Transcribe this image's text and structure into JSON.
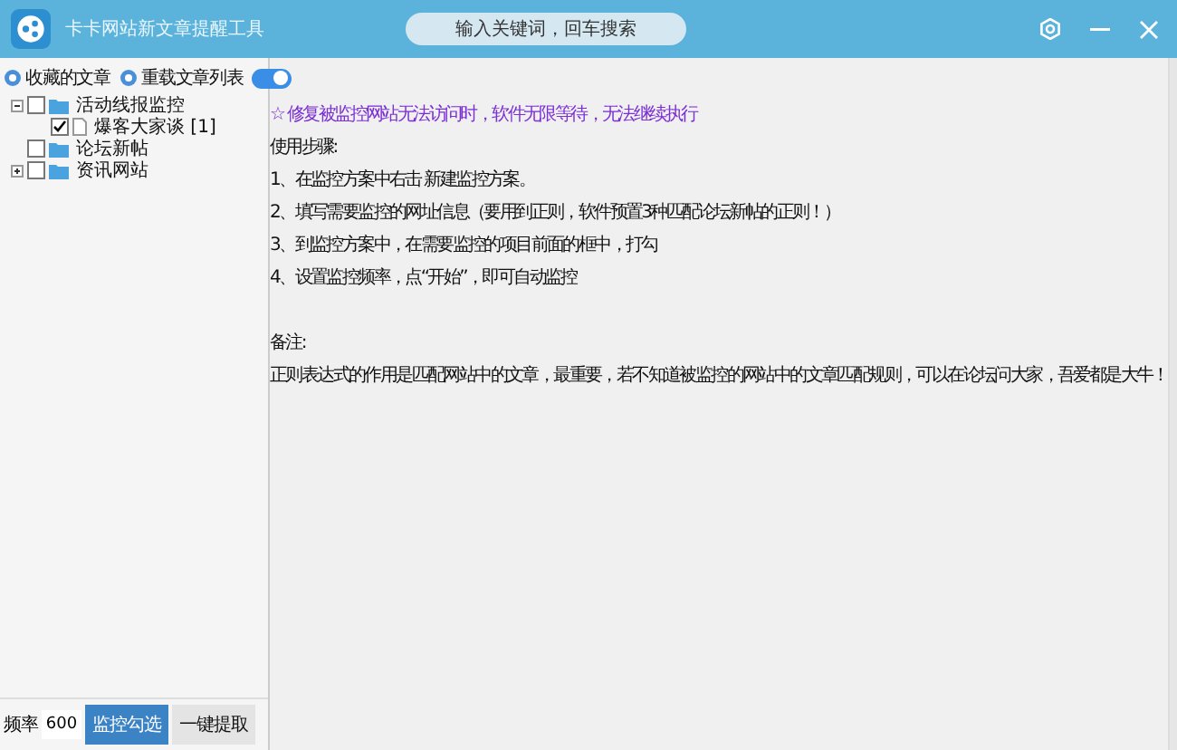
{
  "window": {
    "title": "卡卡网站新文章提醒工具"
  },
  "search": {
    "placeholder": "输入关键词，回车搜索"
  },
  "sidebar": {
    "links": [
      {
        "label": "收藏的文章"
      },
      {
        "label": "重载文章列表"
      }
    ],
    "toggle": {
      "on": true
    },
    "tree": [
      {
        "label": "活动线报监控",
        "checked": false,
        "expanded": true,
        "children": [
          {
            "label": "爆客大家谈 [1]",
            "checked": true
          }
        ]
      },
      {
        "label": "论坛新帖",
        "checked": false
      },
      {
        "label": "资讯网站",
        "checked": false,
        "expanded": false
      }
    ]
  },
  "footer": {
    "frequency_label": "频率",
    "frequency": "600",
    "buttons": [
      {
        "label": "监控勾选",
        "selected": true
      },
      {
        "label": "一键提取",
        "selected": false
      }
    ]
  },
  "content": {
    "lines": [
      {
        "kind": "notice",
        "text": "☆ 修复被监控网站无法访问时，软件无限等待，无法继续执行"
      },
      {
        "kind": "text",
        "text": "使用步骤:"
      },
      {
        "kind": "text",
        "text": "1、在监控方案中右击 新建监控方案。"
      },
      {
        "kind": "text",
        "text": "2、填写需要监控的网址信息（要用到正则，软件预置3种匹配论坛新帖的正则！）"
      },
      {
        "kind": "text",
        "text": "3、到监控方案中，在需要监控的项目前面的框中，打勾"
      },
      {
        "kind": "text",
        "text": "4、设置监控频率，点“开始”，即可自动监控"
      },
      {
        "kind": "gap"
      },
      {
        "kind": "text",
        "text": "备注:"
      },
      {
        "kind": "text",
        "text": "正则表达式的作用是匹配网站中的文章，最重要，若不知道被监控的网站中的文章匹配规则，可以在论坛问大家，吾爱都是大牛！"
      }
    ]
  }
}
